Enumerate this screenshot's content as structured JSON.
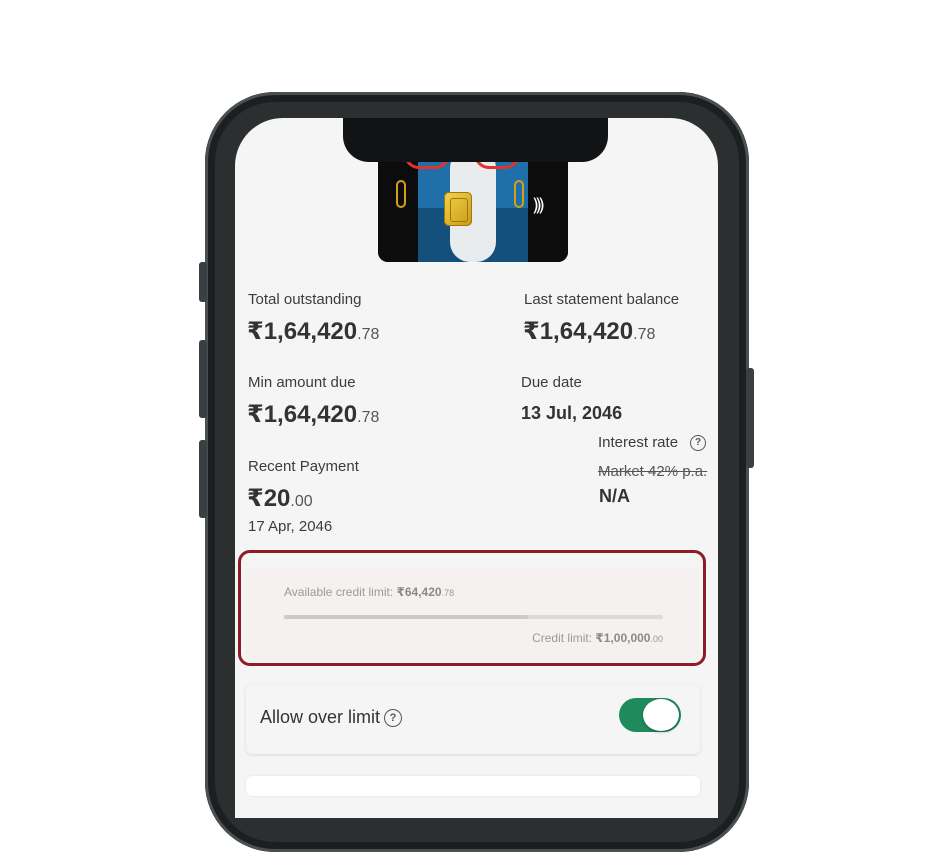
{
  "summary": {
    "total_outstanding": {
      "label": "Total outstanding",
      "whole": "₹1,64,420",
      "decimal": ".78"
    },
    "last_statement": {
      "label": "Last statement balance",
      "whole": "₹1,64,420",
      "decimal": ".78"
    },
    "min_amount_due": {
      "label": "Min amount due",
      "whole": "₹1,64,420",
      "decimal": ".78"
    },
    "due_date": {
      "label": "Due date",
      "value": "13 Jul, 2046"
    },
    "interest_rate": {
      "label": "Interest rate",
      "help": "?",
      "market": "Market 42% p.a.",
      "value": "N/A"
    },
    "recent_payment": {
      "label": "Recent Payment",
      "whole": "₹20",
      "decimal": ".00",
      "date": "17 Apr, 2046"
    }
  },
  "credit": {
    "available_label": "Available credit limit: ",
    "available_whole": "₹64,420",
    "available_decimal": ".78",
    "limit_label": "Credit limit: ",
    "limit_whole": "₹1,00,000",
    "limit_decimal": ".00",
    "available_fraction": 0.6442
  },
  "over_limit": {
    "label": "Allow over limit",
    "help": "?",
    "enabled": true
  },
  "colors": {
    "toggle_on": "#1f8a5b",
    "highlight_border": "#8b1d27"
  },
  "icons": [
    "chip-icon",
    "contactless-icon",
    "help-icon"
  ]
}
